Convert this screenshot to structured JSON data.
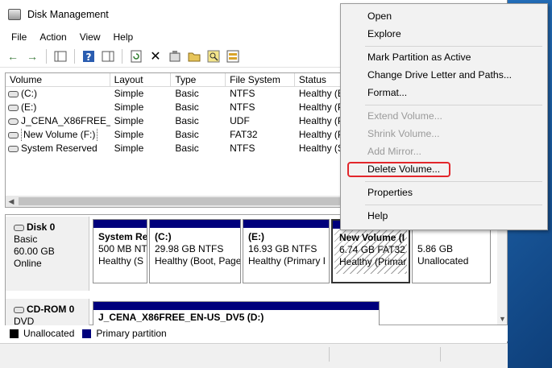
{
  "window": {
    "title": "Disk Management"
  },
  "menubar": [
    "File",
    "Action",
    "View",
    "Help"
  ],
  "toolbar_icons": [
    "back-icon",
    "forward-icon",
    "console-tree-icon",
    "help-icon",
    "properties-pane-icon",
    "refresh-icon",
    "delete-icon",
    "settings-icon",
    "open-folder-icon",
    "search-icon",
    "disk-wizard-icon"
  ],
  "volume_list": {
    "columns": [
      "Volume",
      "Layout",
      "Type",
      "File System",
      "Status"
    ],
    "rows": [
      [
        "(C:)",
        "Simple",
        "Basic",
        "NTFS",
        "Healthy (B"
      ],
      [
        "(E:)",
        "Simple",
        "Basic",
        "NTFS",
        "Healthy (P"
      ],
      [
        "J_CENA_X86FREE_...",
        "Simple",
        "Basic",
        "UDF",
        "Healthy (P"
      ],
      [
        "New Volume (F:)",
        "Simple",
        "Basic",
        "FAT32",
        "Healthy (P"
      ],
      [
        "System Reserved",
        "Simple",
        "Basic",
        "NTFS",
        "Healthy (S"
      ]
    ]
  },
  "disks": [
    {
      "label": "Disk 0",
      "kind": "Basic",
      "size": "60.00 GB",
      "state": "Online",
      "partitions": [
        {
          "name": "System Re",
          "size": "500 MB NT",
          "status": "Healthy (S"
        },
        {
          "name": "(C:)",
          "size": "29.98 GB NTFS",
          "status": "Healthy (Boot, Page"
        },
        {
          "name": "(E:)",
          "size": "16.93 GB NTFS",
          "status": "Healthy (Primary I"
        },
        {
          "name": "New Volume  (I",
          "size": "6.74 GB FAT32",
          "status": "Healthy (Primar"
        },
        {
          "name": "",
          "size": "5.86 GB",
          "status": "Unallocated"
        }
      ]
    },
    {
      "label": "CD-ROM 0",
      "kind": "DVD",
      "partitions": [
        {
          "name": "J_CENA_X86FREE_EN-US_DV5  (D:)"
        }
      ]
    }
  ],
  "legend": [
    {
      "label": "Unallocated",
      "color": "#000000"
    },
    {
      "label": "Primary partition",
      "color": "#00007c"
    }
  ],
  "context_menu": {
    "open": "Open",
    "explore": "Explore",
    "mark_active": "Mark Partition as Active",
    "change_letter": "Change Drive Letter and Paths...",
    "format": "Format...",
    "extend": "Extend Volume...",
    "shrink": "Shrink Volume...",
    "add_mirror": "Add Mirror...",
    "delete": "Delete Volume...",
    "properties": "Properties",
    "help": "Help"
  },
  "colors": {
    "primary_partition": "#00007c",
    "unallocated": "#000000",
    "highlight": "#e2262b"
  }
}
